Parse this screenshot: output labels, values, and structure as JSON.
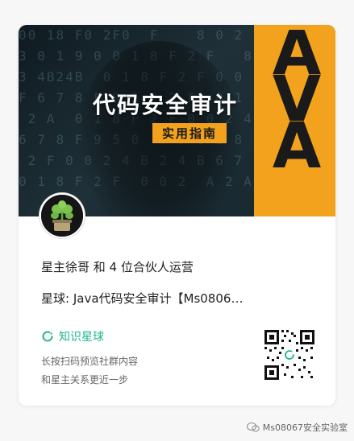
{
  "banner": {
    "title": "代码安全审计",
    "badge": "实用指南",
    "side_text": "AVA"
  },
  "owner_line": "星主徐哥 和 4 位合伙人运营",
  "planet_line": "星球: Java代码安全审计【Ms0806…",
  "zsxq": {
    "label": "知识星球",
    "icon": "zsxq-logo-icon",
    "color": "#1eb78f"
  },
  "hints": {
    "line1": "长按扫码预览社群内容",
    "line2": "和星主关系更近一步"
  },
  "watermark": "Ms08067安全实验室",
  "colors": {
    "accent_orange": "#f2a21c",
    "zsxq_green": "#1eb78f"
  }
}
